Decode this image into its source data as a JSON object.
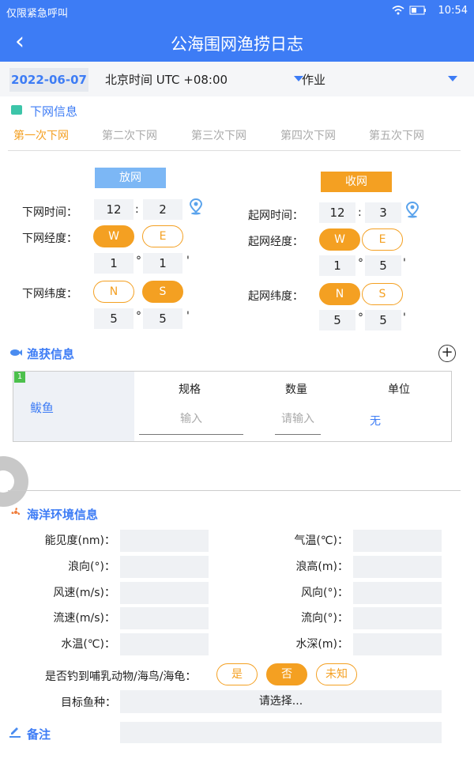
{
  "status": {
    "left_text": "仅限紧急呼叫",
    "time": "10:54"
  },
  "header": {
    "back_icon": "‹",
    "title": "公海围网渔捞日志"
  },
  "date_row": {
    "date": "2022-06-07",
    "timezone": "北京时间 UTC +08:00",
    "operation": "作业"
  },
  "net_section": {
    "title": "下网信息",
    "tabs": [
      "第一次下网",
      "第二次下网",
      "第三次下网",
      "第四次下网",
      "第五次下网"
    ],
    "cast": {
      "badge": "放网",
      "time_label": "下网时间：",
      "hour": "12",
      "minute": "2",
      "colon": ":",
      "lon_label": "下网经度：",
      "lon_w": "W",
      "lon_e": "E",
      "lon_selected": "W",
      "lon_deg": "1",
      "lon_min": "1",
      "lat_label": "下网纬度：",
      "lat_n": "N",
      "lat_s": "S",
      "lat_selected": "S",
      "lat_deg": "5",
      "lat_min": "5",
      "deg_sym": "°",
      "min_sym": "'"
    },
    "haul": {
      "badge": "收网",
      "time_label": "起网时间：",
      "hour": "12",
      "minute": "3",
      "colon": ":",
      "lon_label": "起网经度：",
      "lon_w": "W",
      "lon_e": "E",
      "lon_selected": "W",
      "lon_deg": "1",
      "lon_min": "5",
      "lat_label": "起网纬度：",
      "lat_n": "N",
      "lat_s": "S",
      "lat_selected": "N",
      "lat_deg": "5",
      "lat_min": "5",
      "deg_sym": "°",
      "min_sym": "'"
    }
  },
  "catch_section": {
    "title": "渔获信息",
    "add_icon": "+",
    "item": {
      "index": "1",
      "name": "鲅鱼",
      "col_spec": "规格",
      "col_qty": "数量",
      "col_unit": "单位",
      "spec_placeholder": "输入",
      "qty_placeholder": "请输入",
      "unit_value": "无"
    }
  },
  "env_section": {
    "title": "海洋环境信息",
    "fields": [
      {
        "label": "能见度(nm)：",
        "label2": "气温(℃)："
      },
      {
        "label": "浪向(°)：",
        "label2": "浪高(m)："
      },
      {
        "label": "风速(m/s)：",
        "label2": "风向(°)："
      },
      {
        "label": "流速(m/s)：",
        "label2": "流向(°)："
      },
      {
        "label": "水温(℃)：",
        "label2": "水深(m)："
      }
    ],
    "bycatch_label": "是否钓到哺乳动物/海鸟/海龟：",
    "bycatch_options": [
      "是",
      "否",
      "未知"
    ],
    "bycatch_selected": "否",
    "target_label": "目标鱼种：",
    "target_placeholder": "请选择..."
  },
  "notes_section": {
    "title": "备注"
  },
  "colors": {
    "primary": "#3d7cf5",
    "accent": "#f4a022"
  }
}
